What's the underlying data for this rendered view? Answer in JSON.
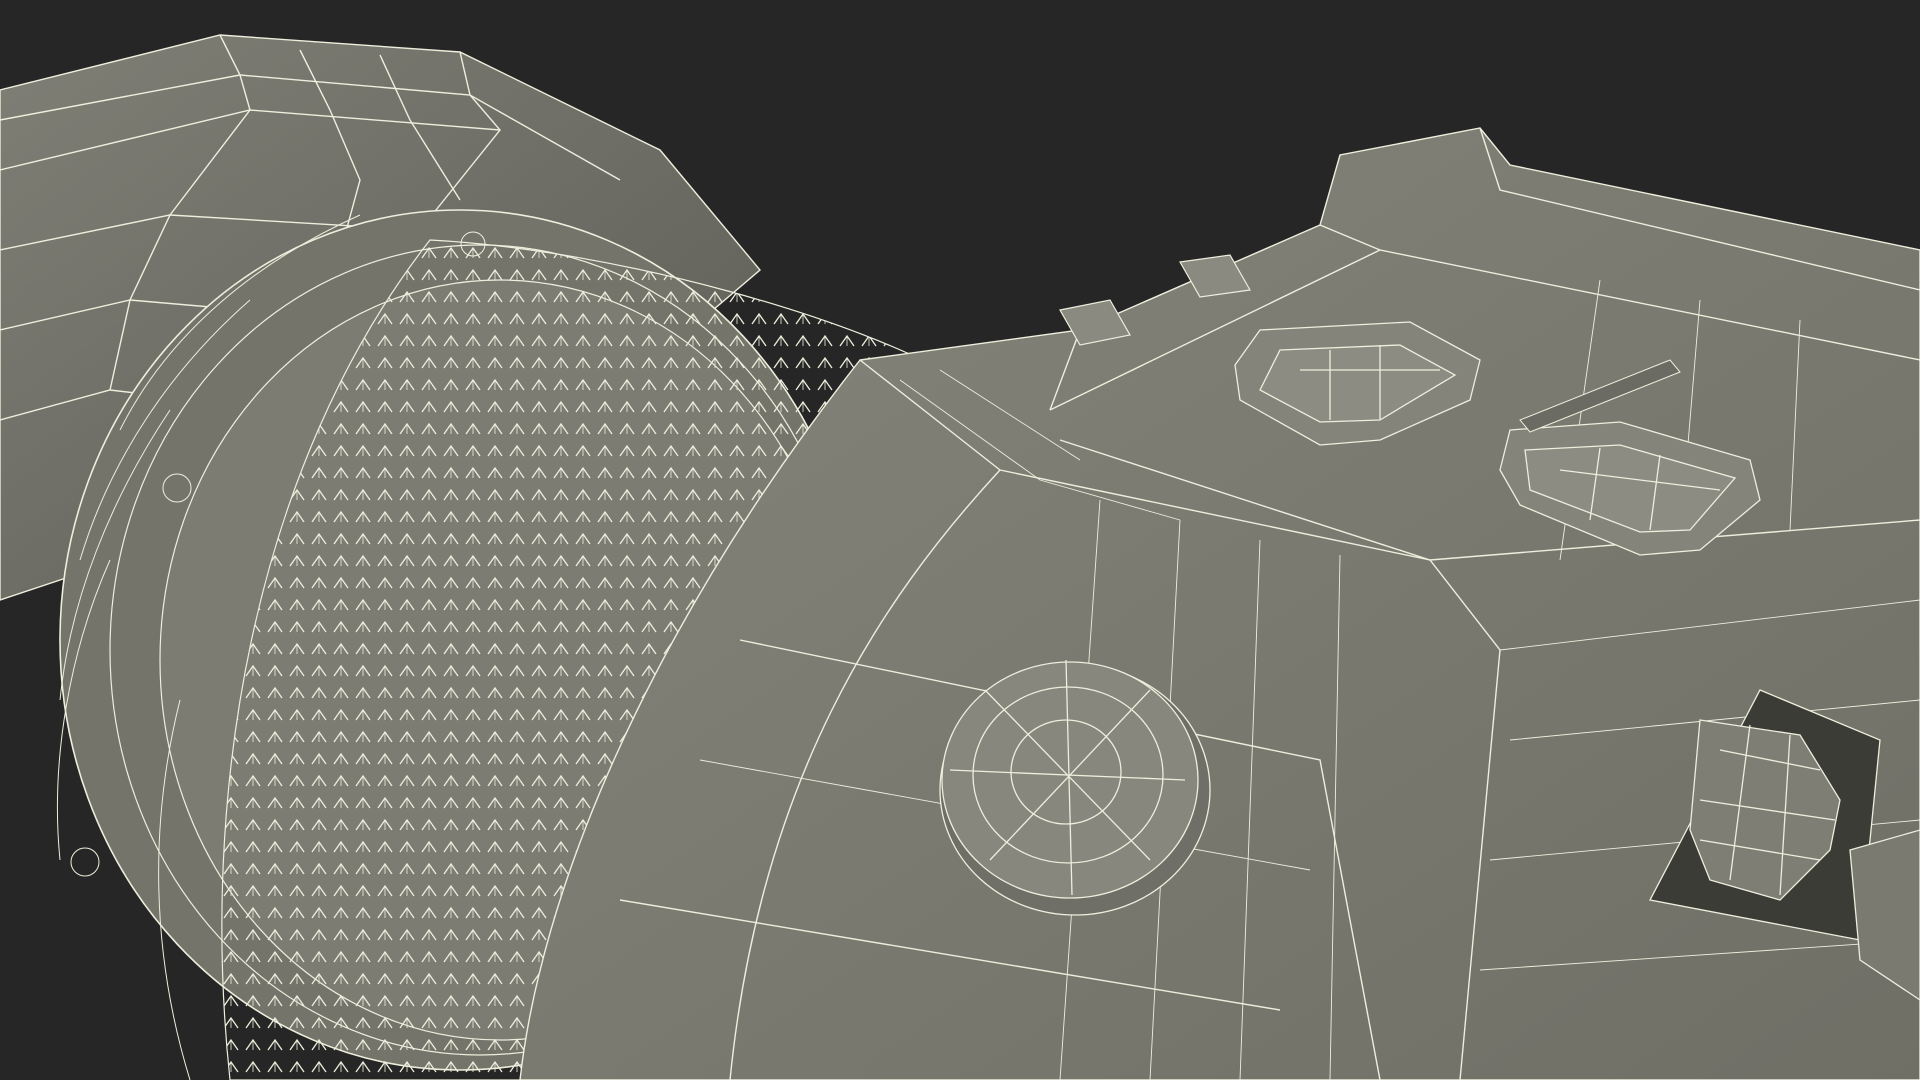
{
  "scene": {
    "subject": "3d-wireframe-render",
    "colors": {
      "background": "#262626",
      "surface": "#7a7a70",
      "surface_light": "#8a8a80",
      "surface_dark": "#5e5e56",
      "wire": "#eeeedd"
    }
  }
}
